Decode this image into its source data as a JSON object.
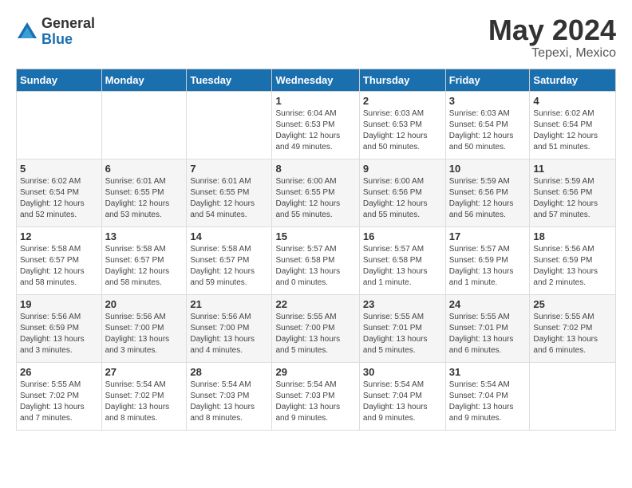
{
  "header": {
    "logo": {
      "general": "General",
      "blue": "Blue"
    },
    "month_year": "May 2024",
    "location": "Tepexi, Mexico"
  },
  "weekdays": [
    "Sunday",
    "Monday",
    "Tuesday",
    "Wednesday",
    "Thursday",
    "Friday",
    "Saturday"
  ],
  "weeks": [
    [
      {
        "day": "",
        "info": ""
      },
      {
        "day": "",
        "info": ""
      },
      {
        "day": "",
        "info": ""
      },
      {
        "day": "1",
        "info": "Sunrise: 6:04 AM\nSunset: 6:53 PM\nDaylight: 12 hours\nand 49 minutes."
      },
      {
        "day": "2",
        "info": "Sunrise: 6:03 AM\nSunset: 6:53 PM\nDaylight: 12 hours\nand 50 minutes."
      },
      {
        "day": "3",
        "info": "Sunrise: 6:03 AM\nSunset: 6:54 PM\nDaylight: 12 hours\nand 50 minutes."
      },
      {
        "day": "4",
        "info": "Sunrise: 6:02 AM\nSunset: 6:54 PM\nDaylight: 12 hours\nand 51 minutes."
      }
    ],
    [
      {
        "day": "5",
        "info": "Sunrise: 6:02 AM\nSunset: 6:54 PM\nDaylight: 12 hours\nand 52 minutes."
      },
      {
        "day": "6",
        "info": "Sunrise: 6:01 AM\nSunset: 6:55 PM\nDaylight: 12 hours\nand 53 minutes."
      },
      {
        "day": "7",
        "info": "Sunrise: 6:01 AM\nSunset: 6:55 PM\nDaylight: 12 hours\nand 54 minutes."
      },
      {
        "day": "8",
        "info": "Sunrise: 6:00 AM\nSunset: 6:55 PM\nDaylight: 12 hours\nand 55 minutes."
      },
      {
        "day": "9",
        "info": "Sunrise: 6:00 AM\nSunset: 6:56 PM\nDaylight: 12 hours\nand 55 minutes."
      },
      {
        "day": "10",
        "info": "Sunrise: 5:59 AM\nSunset: 6:56 PM\nDaylight: 12 hours\nand 56 minutes."
      },
      {
        "day": "11",
        "info": "Sunrise: 5:59 AM\nSunset: 6:56 PM\nDaylight: 12 hours\nand 57 minutes."
      }
    ],
    [
      {
        "day": "12",
        "info": "Sunrise: 5:58 AM\nSunset: 6:57 PM\nDaylight: 12 hours\nand 58 minutes."
      },
      {
        "day": "13",
        "info": "Sunrise: 5:58 AM\nSunset: 6:57 PM\nDaylight: 12 hours\nand 58 minutes."
      },
      {
        "day": "14",
        "info": "Sunrise: 5:58 AM\nSunset: 6:57 PM\nDaylight: 12 hours\nand 59 minutes."
      },
      {
        "day": "15",
        "info": "Sunrise: 5:57 AM\nSunset: 6:58 PM\nDaylight: 13 hours\nand 0 minutes."
      },
      {
        "day": "16",
        "info": "Sunrise: 5:57 AM\nSunset: 6:58 PM\nDaylight: 13 hours\nand 1 minute."
      },
      {
        "day": "17",
        "info": "Sunrise: 5:57 AM\nSunset: 6:59 PM\nDaylight: 13 hours\nand 1 minute."
      },
      {
        "day": "18",
        "info": "Sunrise: 5:56 AM\nSunset: 6:59 PM\nDaylight: 13 hours\nand 2 minutes."
      }
    ],
    [
      {
        "day": "19",
        "info": "Sunrise: 5:56 AM\nSunset: 6:59 PM\nDaylight: 13 hours\nand 3 minutes."
      },
      {
        "day": "20",
        "info": "Sunrise: 5:56 AM\nSunset: 7:00 PM\nDaylight: 13 hours\nand 3 minutes."
      },
      {
        "day": "21",
        "info": "Sunrise: 5:56 AM\nSunset: 7:00 PM\nDaylight: 13 hours\nand 4 minutes."
      },
      {
        "day": "22",
        "info": "Sunrise: 5:55 AM\nSunset: 7:00 PM\nDaylight: 13 hours\nand 5 minutes."
      },
      {
        "day": "23",
        "info": "Sunrise: 5:55 AM\nSunset: 7:01 PM\nDaylight: 13 hours\nand 5 minutes."
      },
      {
        "day": "24",
        "info": "Sunrise: 5:55 AM\nSunset: 7:01 PM\nDaylight: 13 hours\nand 6 minutes."
      },
      {
        "day": "25",
        "info": "Sunrise: 5:55 AM\nSunset: 7:02 PM\nDaylight: 13 hours\nand 6 minutes."
      }
    ],
    [
      {
        "day": "26",
        "info": "Sunrise: 5:55 AM\nSunset: 7:02 PM\nDaylight: 13 hours\nand 7 minutes."
      },
      {
        "day": "27",
        "info": "Sunrise: 5:54 AM\nSunset: 7:02 PM\nDaylight: 13 hours\nand 8 minutes."
      },
      {
        "day": "28",
        "info": "Sunrise: 5:54 AM\nSunset: 7:03 PM\nDaylight: 13 hours\nand 8 minutes."
      },
      {
        "day": "29",
        "info": "Sunrise: 5:54 AM\nSunset: 7:03 PM\nDaylight: 13 hours\nand 9 minutes."
      },
      {
        "day": "30",
        "info": "Sunrise: 5:54 AM\nSunset: 7:04 PM\nDaylight: 13 hours\nand 9 minutes."
      },
      {
        "day": "31",
        "info": "Sunrise: 5:54 AM\nSunset: 7:04 PM\nDaylight: 13 hours\nand 9 minutes."
      },
      {
        "day": "",
        "info": ""
      }
    ]
  ]
}
